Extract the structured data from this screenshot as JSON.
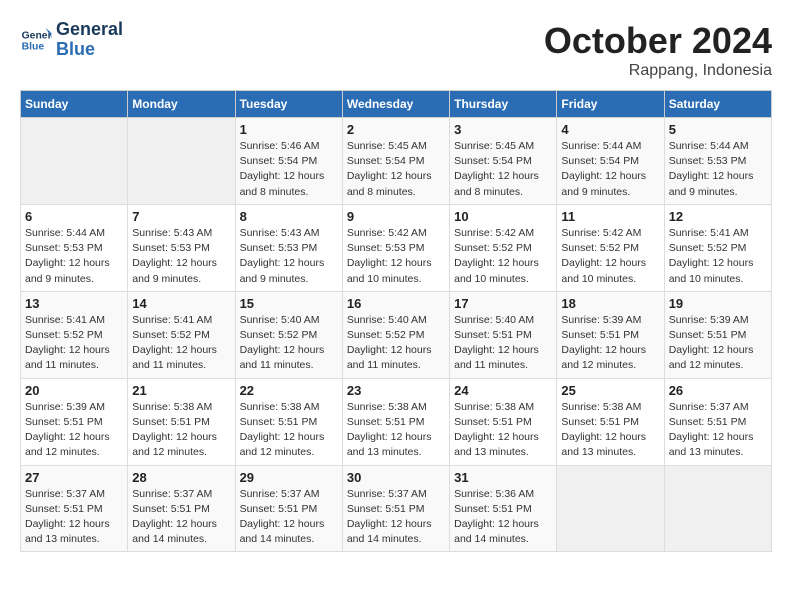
{
  "header": {
    "logo_general": "General",
    "logo_blue": "Blue",
    "month": "October 2024",
    "location": "Rappang, Indonesia"
  },
  "days_of_week": [
    "Sunday",
    "Monday",
    "Tuesday",
    "Wednesday",
    "Thursday",
    "Friday",
    "Saturday"
  ],
  "weeks": [
    [
      {
        "day": "",
        "info": ""
      },
      {
        "day": "",
        "info": ""
      },
      {
        "day": "1",
        "info": "Sunrise: 5:46 AM\nSunset: 5:54 PM\nDaylight: 12 hours and 8 minutes."
      },
      {
        "day": "2",
        "info": "Sunrise: 5:45 AM\nSunset: 5:54 PM\nDaylight: 12 hours and 8 minutes."
      },
      {
        "day": "3",
        "info": "Sunrise: 5:45 AM\nSunset: 5:54 PM\nDaylight: 12 hours and 8 minutes."
      },
      {
        "day": "4",
        "info": "Sunrise: 5:44 AM\nSunset: 5:54 PM\nDaylight: 12 hours and 9 minutes."
      },
      {
        "day": "5",
        "info": "Sunrise: 5:44 AM\nSunset: 5:53 PM\nDaylight: 12 hours and 9 minutes."
      }
    ],
    [
      {
        "day": "6",
        "info": "Sunrise: 5:44 AM\nSunset: 5:53 PM\nDaylight: 12 hours and 9 minutes."
      },
      {
        "day": "7",
        "info": "Sunrise: 5:43 AM\nSunset: 5:53 PM\nDaylight: 12 hours and 9 minutes."
      },
      {
        "day": "8",
        "info": "Sunrise: 5:43 AM\nSunset: 5:53 PM\nDaylight: 12 hours and 9 minutes."
      },
      {
        "day": "9",
        "info": "Sunrise: 5:42 AM\nSunset: 5:53 PM\nDaylight: 12 hours and 10 minutes."
      },
      {
        "day": "10",
        "info": "Sunrise: 5:42 AM\nSunset: 5:52 PM\nDaylight: 12 hours and 10 minutes."
      },
      {
        "day": "11",
        "info": "Sunrise: 5:42 AM\nSunset: 5:52 PM\nDaylight: 12 hours and 10 minutes."
      },
      {
        "day": "12",
        "info": "Sunrise: 5:41 AM\nSunset: 5:52 PM\nDaylight: 12 hours and 10 minutes."
      }
    ],
    [
      {
        "day": "13",
        "info": "Sunrise: 5:41 AM\nSunset: 5:52 PM\nDaylight: 12 hours and 11 minutes."
      },
      {
        "day": "14",
        "info": "Sunrise: 5:41 AM\nSunset: 5:52 PM\nDaylight: 12 hours and 11 minutes."
      },
      {
        "day": "15",
        "info": "Sunrise: 5:40 AM\nSunset: 5:52 PM\nDaylight: 12 hours and 11 minutes."
      },
      {
        "day": "16",
        "info": "Sunrise: 5:40 AM\nSunset: 5:52 PM\nDaylight: 12 hours and 11 minutes."
      },
      {
        "day": "17",
        "info": "Sunrise: 5:40 AM\nSunset: 5:51 PM\nDaylight: 12 hours and 11 minutes."
      },
      {
        "day": "18",
        "info": "Sunrise: 5:39 AM\nSunset: 5:51 PM\nDaylight: 12 hours and 12 minutes."
      },
      {
        "day": "19",
        "info": "Sunrise: 5:39 AM\nSunset: 5:51 PM\nDaylight: 12 hours and 12 minutes."
      }
    ],
    [
      {
        "day": "20",
        "info": "Sunrise: 5:39 AM\nSunset: 5:51 PM\nDaylight: 12 hours and 12 minutes."
      },
      {
        "day": "21",
        "info": "Sunrise: 5:38 AM\nSunset: 5:51 PM\nDaylight: 12 hours and 12 minutes."
      },
      {
        "day": "22",
        "info": "Sunrise: 5:38 AM\nSunset: 5:51 PM\nDaylight: 12 hours and 12 minutes."
      },
      {
        "day": "23",
        "info": "Sunrise: 5:38 AM\nSunset: 5:51 PM\nDaylight: 12 hours and 13 minutes."
      },
      {
        "day": "24",
        "info": "Sunrise: 5:38 AM\nSunset: 5:51 PM\nDaylight: 12 hours and 13 minutes."
      },
      {
        "day": "25",
        "info": "Sunrise: 5:38 AM\nSunset: 5:51 PM\nDaylight: 12 hours and 13 minutes."
      },
      {
        "day": "26",
        "info": "Sunrise: 5:37 AM\nSunset: 5:51 PM\nDaylight: 12 hours and 13 minutes."
      }
    ],
    [
      {
        "day": "27",
        "info": "Sunrise: 5:37 AM\nSunset: 5:51 PM\nDaylight: 12 hours and 13 minutes."
      },
      {
        "day": "28",
        "info": "Sunrise: 5:37 AM\nSunset: 5:51 PM\nDaylight: 12 hours and 14 minutes."
      },
      {
        "day": "29",
        "info": "Sunrise: 5:37 AM\nSunset: 5:51 PM\nDaylight: 12 hours and 14 minutes."
      },
      {
        "day": "30",
        "info": "Sunrise: 5:37 AM\nSunset: 5:51 PM\nDaylight: 12 hours and 14 minutes."
      },
      {
        "day": "31",
        "info": "Sunrise: 5:36 AM\nSunset: 5:51 PM\nDaylight: 12 hours and 14 minutes."
      },
      {
        "day": "",
        "info": ""
      },
      {
        "day": "",
        "info": ""
      }
    ]
  ]
}
